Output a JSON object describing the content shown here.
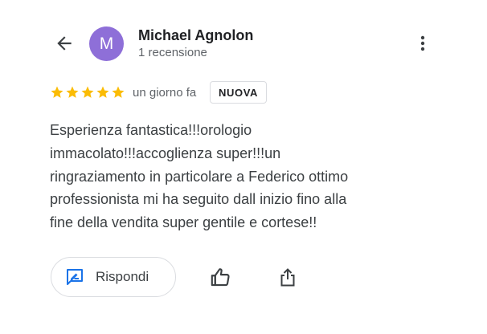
{
  "header": {
    "avatar_letter": "M",
    "avatar_color": "#8e6fd8",
    "author_name": "Michael Agnolon",
    "author_subtitle": "1 recensione",
    "back_icon": "arrow-back-icon",
    "menu_icon": "more-vert-icon"
  },
  "rating": {
    "stars": 5,
    "max_stars": 5,
    "star_color": "#fbbc04",
    "time_ago": "un giorno fa",
    "badge": "NUOVA"
  },
  "review": {
    "lines": [
      "Esperienza fantastica!!!orologio",
      "immacolato!!!accoglienza super!!!un",
      "ringraziamento in particolare a Federico ottimo",
      "professionista mi ha seguito dall inizio fino alla",
      "fine della vendita super gentile e cortese!!"
    ]
  },
  "actions": {
    "reply_label": "Rispondi",
    "reply_icon": "rate-review-icon",
    "reply_icon_color": "#1a73e8",
    "like_icon": "thumb-up-icon",
    "share_icon": "share-icon"
  }
}
